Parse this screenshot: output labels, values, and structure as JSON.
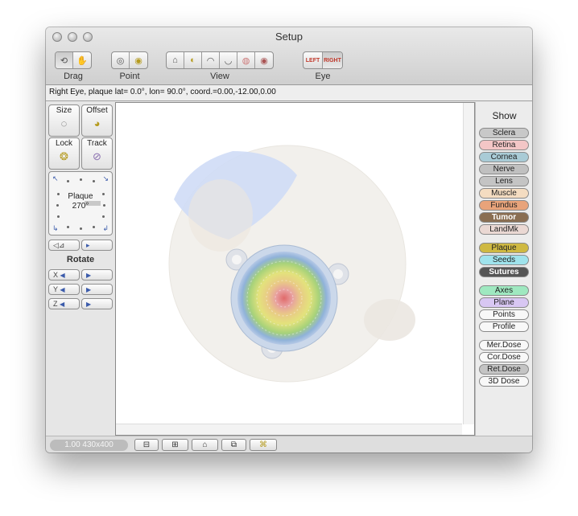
{
  "window": {
    "title": "Setup"
  },
  "toolbar": {
    "groups": [
      {
        "label": "Drag",
        "icons": [
          "rotate-drag-icon",
          "hand-drag-icon"
        ]
      },
      {
        "label": "Point",
        "icons": [
          "point-target-icon",
          "point-select-icon"
        ]
      },
      {
        "label": "View",
        "icons": [
          "home-view-icon",
          "zoom-view-icon",
          "top-view-icon",
          "bottom-view-icon",
          "side-view-icon",
          "front-view-icon"
        ]
      },
      {
        "label": "Eye",
        "buttons": [
          "LEFT",
          "RIGHT"
        ]
      }
    ]
  },
  "status": {
    "text": "Right Eye, plaque lat=  0.0°, lon= 90.0°, coord.=0.00,-12.00,0.00"
  },
  "left_panel": {
    "size_label": "Size",
    "offset_label": "Offset",
    "lock_label": "Lock",
    "track_label": "Track",
    "dial_label": "Plaque",
    "dial_value": "270°",
    "rotate_title": "Rotate",
    "rotate_rows": [
      {
        "axis": "X",
        "left_arrow": "◀",
        "right_arrow": "▶"
      },
      {
        "axis": "Y",
        "left_arrow": "◀",
        "right_arrow": "▶"
      },
      {
        "axis": "Z",
        "left_arrow": "◀",
        "right_arrow": "▶"
      }
    ]
  },
  "show_panel": {
    "title": "Show",
    "items": [
      {
        "label": "Sclera",
        "color": "#c8c8c8"
      },
      {
        "label": "Retina",
        "color": "#f3c6c6"
      },
      {
        "label": "Cornea",
        "color": "#a9cbd6"
      },
      {
        "label": "Nerve",
        "color": "#c0c0c0"
      },
      {
        "label": "Lens",
        "color": "#c4c4c4"
      },
      {
        "label": "Muscle",
        "color": "#f4dcc1"
      },
      {
        "label": "Fundus",
        "color": "#e8a37a"
      },
      {
        "label": "Tumor",
        "color": "#8a6e52"
      },
      {
        "label": "LandMk",
        "color": "#ead8d3"
      },
      {
        "label": "Plaque",
        "color": "#cfb942"
      },
      {
        "label": "Seeds",
        "color": "#9fe3ec"
      },
      {
        "label": "Sutures",
        "color": "#555555"
      },
      {
        "label": "Axes",
        "color": "#9fe8c0"
      },
      {
        "label": "Plane",
        "color": "#d8c7f3"
      },
      {
        "label": "Points",
        "color": "#f8f8f8"
      },
      {
        "label": "Profile",
        "color": "#f8f8f8"
      },
      {
        "label": "Mer.Dose",
        "color": "#f8f8f8"
      },
      {
        "label": "Cor.Dose",
        "color": "#f8f8f8"
      },
      {
        "label": "Ret.Dose",
        "color": "#c4c4c4"
      },
      {
        "label": "3D Dose",
        "color": "#f8f8f8"
      }
    ]
  },
  "bottom_bar": {
    "zoom_text": "1.00 430x400",
    "buttons": [
      "zoom-out-icon",
      "zoom-in-icon",
      "home-icon",
      "snapshot-icon",
      "animate-icon"
    ]
  }
}
